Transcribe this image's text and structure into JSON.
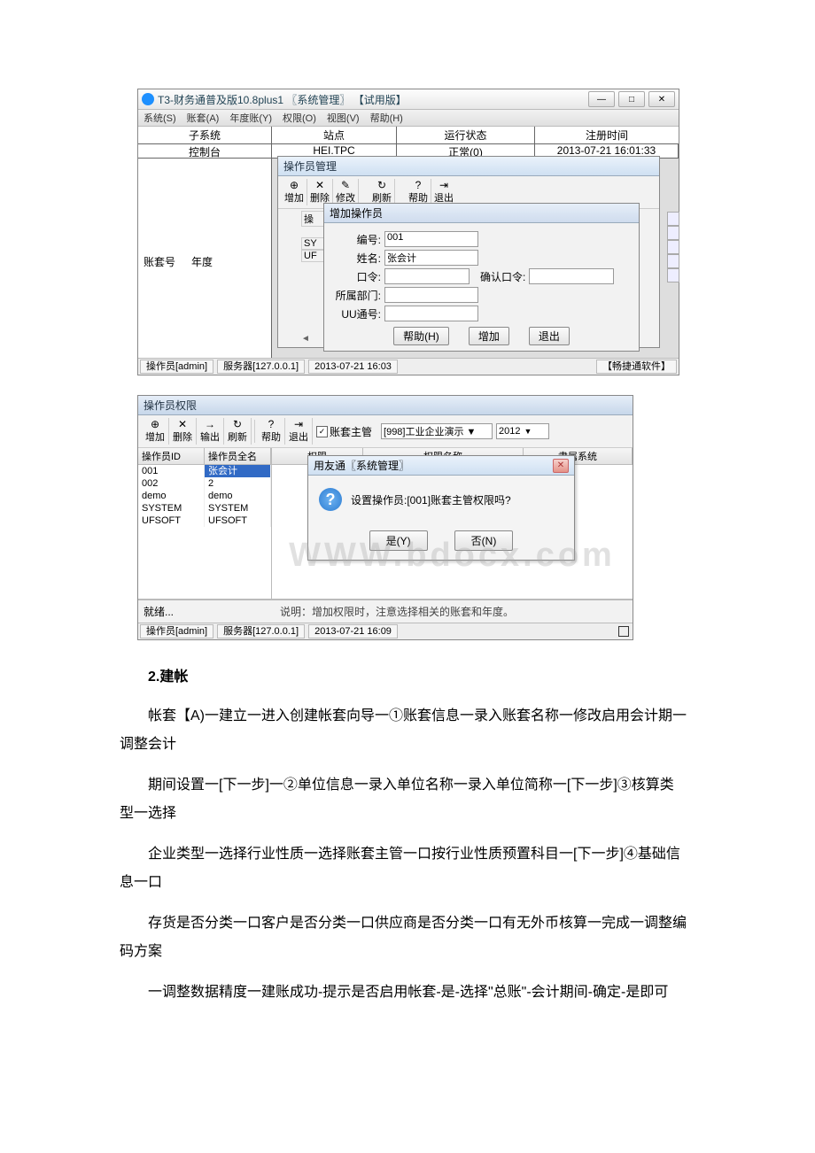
{
  "win1": {
    "title": "T3-财务通普及版10.8plus1 〖系统管理〗 【试用版】",
    "winbtns": {
      "min": "—",
      "max": "□",
      "close": "✕"
    },
    "menu": [
      "系统(S)",
      "账套(A)",
      "年度账(Y)",
      "权限(O)",
      "视图(V)",
      "帮助(H)"
    ],
    "grid": {
      "headers": [
        "子系统",
        "站点",
        "运行状态",
        "注册时间"
      ],
      "row": {
        "c1": "控制台",
        "c2": "HEI.TPC",
        "c3": "正常(0)",
        "c4": "2013-07-21 16:01:33"
      }
    },
    "left": {
      "label1": "账套号",
      "label2": "年度"
    },
    "opMgr": {
      "title": "操作员管理",
      "tools": [
        {
          "icon": "⊕",
          "label": "增加"
        },
        {
          "icon": "✕",
          "label": "删除"
        },
        {
          "icon": "✎",
          "label": "修改"
        },
        {
          "icon": "↻",
          "label": "刷新"
        },
        {
          "icon": "?",
          "label": "帮助"
        },
        {
          "icon": "⇥",
          "label": "退出"
        }
      ],
      "colprefix": "操",
      "row1": "SY",
      "row2": "UF"
    },
    "addOp": {
      "title": "增加操作员",
      "rows": {
        "id_label": "编号:",
        "id_value": "001",
        "name_label": "姓名:",
        "name_value": "张会计",
        "pwd_label": "口令:",
        "pwd2_label": "确认口令:",
        "dept_label": "所属部门:",
        "uu_label": "UU通号:"
      },
      "btns": {
        "help": "帮助(H)",
        "add": "增加",
        "exit": "退出"
      }
    },
    "status": {
      "op": "操作员[admin]",
      "srv": "服务器[127.0.0.1]",
      "time": "2013-07-21 16:03",
      "brand": "【畅捷通软件】"
    }
  },
  "win2": {
    "title": "操作员权限",
    "tools": [
      {
        "icon": "⊕",
        "label": "增加"
      },
      {
        "icon": "✕",
        "label": "删除"
      },
      {
        "icon": "→",
        "label": "输出"
      },
      {
        "icon": "↻",
        "label": "刷新"
      },
      {
        "icon": "?",
        "label": "帮助"
      },
      {
        "icon": "⇥",
        "label": "退出"
      }
    ],
    "chk": "账套主管",
    "combo1": "[998]工业企业演示 ▼",
    "combo2_value": "2012",
    "combo2_arrow": "▼",
    "left": {
      "headers": [
        "操作员ID",
        "操作员全名"
      ],
      "rows": [
        {
          "id": "001",
          "name": "张会计",
          "sel": true
        },
        {
          "id": "002",
          "name": "2",
          "sel": false
        },
        {
          "id": "demo",
          "name": "demo",
          "sel": false
        },
        {
          "id": "SYSTEM",
          "name": "SYSTEM",
          "sel": false
        },
        {
          "id": "UFSOFT",
          "name": "UFSOFT",
          "sel": false
        }
      ]
    },
    "right": {
      "headers": [
        "权限",
        "权限名称",
        "隶属系统"
      ]
    },
    "msgbox": {
      "title": "用友通〖系统管理〗",
      "close": "✕",
      "q": "?",
      "text": "设置操作员:[001]账套主管权限吗?",
      "yes": "是(Y)",
      "no": "否(N)"
    },
    "watermark": "WWW.bdocx.com",
    "status2": {
      "left": "就绪...",
      "right": "说明：增加权限时，注意选择相关的账套和年度。"
    },
    "status": {
      "op": "操作员[admin]",
      "srv": "服务器[127.0.0.1]",
      "time": "2013-07-21 16:09"
    }
  },
  "doc": {
    "h": "2.建帐",
    "p1": "帐套【A)一建立一进入创建帐套向导一①账套信息一录入账套名称一修改启用会计期一调整会计",
    "p2": "期间设置一[下一步]一②单位信息一录入单位名称一录入单位简称一[下一步]③核算类型一选择",
    "p3": "企业类型一选择行业性质一选择账套主管一口按行业性质预置科目一[下一步]④基础信息一口",
    "p4": "存货是否分类一口客户是否分类一口供应商是否分类一口有无外币核算一完成一调整编码方案",
    "p5": "一调整数据精度一建账成功-提示是否启用帐套-是-选择\"总账\"-会计期间-确定-是即可"
  }
}
